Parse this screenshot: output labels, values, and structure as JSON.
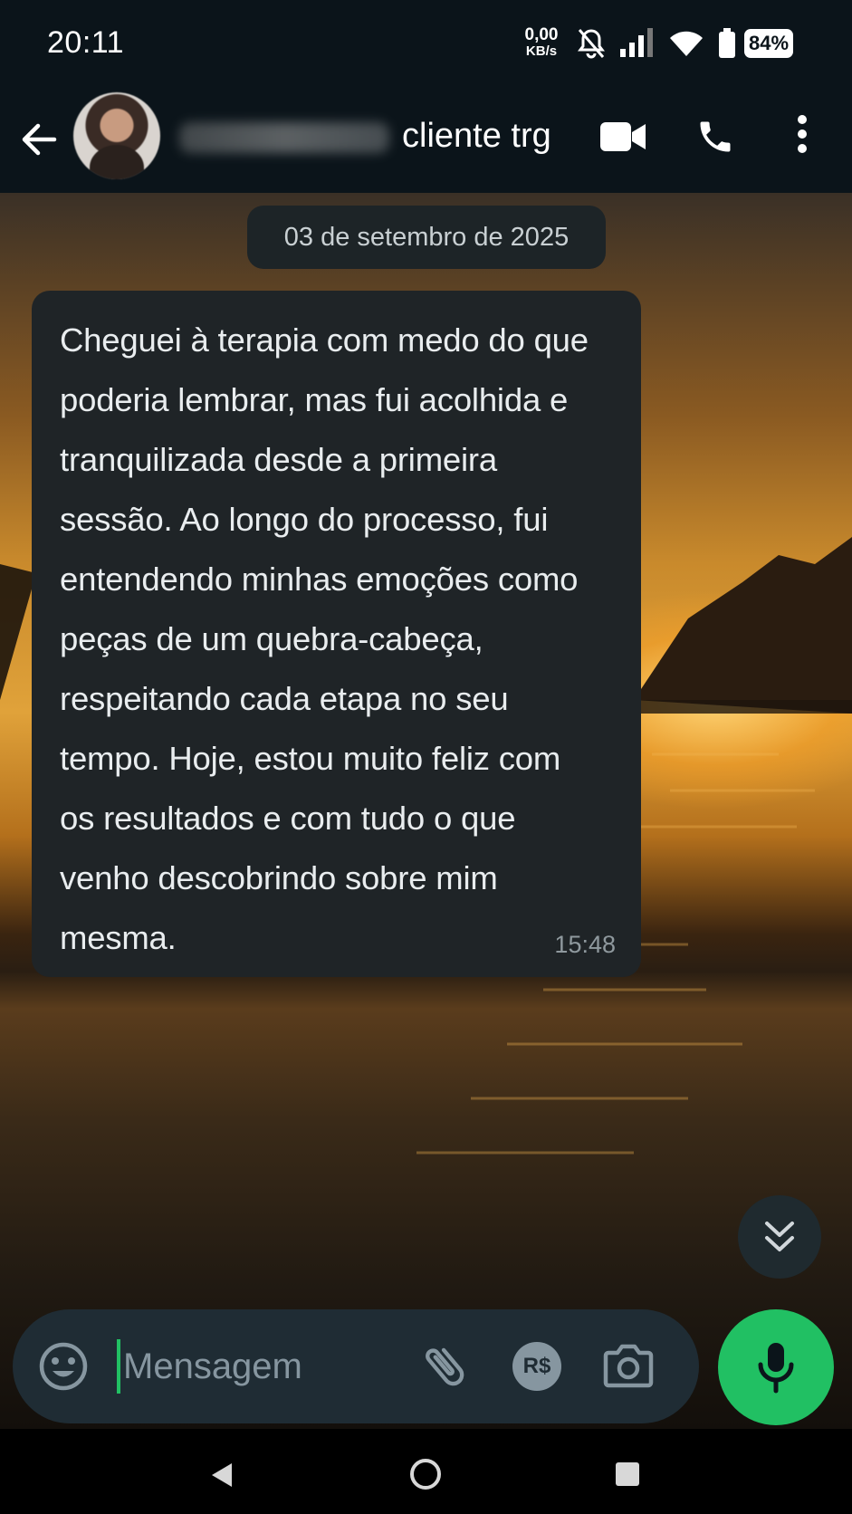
{
  "status_bar": {
    "time": "20:11",
    "net_speed_value": "0,00",
    "net_speed_unit": "KB/s",
    "battery": "84%",
    "icons": [
      "bell-off-icon",
      "signal-icon",
      "wifi-icon",
      "battery-icon"
    ]
  },
  "header": {
    "contact_name": "cliente trg",
    "icons": [
      "back-arrow-icon",
      "video-call-icon",
      "phone-call-icon",
      "more-options-icon"
    ]
  },
  "chat": {
    "date_chip": "03 de setembro de 2025",
    "messages": [
      {
        "text": "Cheguei à terapia com medo do que\npoderia lembrar, mas fui acolhida e\ntranquilizada desde a primeira\nsessão. Ao longo do processo, fui\nentendendo minhas emoções como\npeças de um quebra-cabeça,\nrespeitando cada etapa no seu\ntempo. Hoje, estou muito feliz com\nos resultados e com tudo o que\nvenho descobrindo sobre mim\nmesma.",
        "time": "15:48"
      }
    ]
  },
  "composer": {
    "placeholder": "Mensagem",
    "value": "",
    "payment_label": "R$",
    "icons": [
      "emoji-icon",
      "attach-icon",
      "payment-icon",
      "camera-icon",
      "mic-icon"
    ]
  },
  "colors": {
    "background": "#0b141a",
    "bubble": "#1f2427",
    "composer": "#1f2c34",
    "accent": "#21c063"
  }
}
